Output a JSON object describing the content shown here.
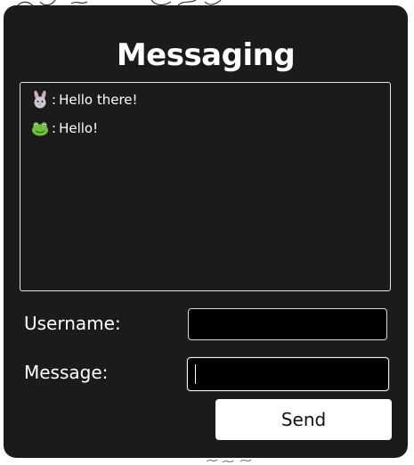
{
  "app": {
    "title": "Messaging"
  },
  "messages": [
    {
      "avatar": "rabbit-avatar",
      "separator": ":",
      "text": "Hello there!"
    },
    {
      "avatar": "frog-avatar",
      "separator": ":",
      "text": "Hello!"
    }
  ],
  "form": {
    "username_label": "Username:",
    "username_value": "",
    "message_label": "Message:",
    "message_value": "",
    "send_label": "Send"
  },
  "colors": {
    "panel_bg": "#1b1b1b",
    "input_bg": "#000000",
    "button_bg": "#ffffff",
    "text": "#ffffff"
  }
}
